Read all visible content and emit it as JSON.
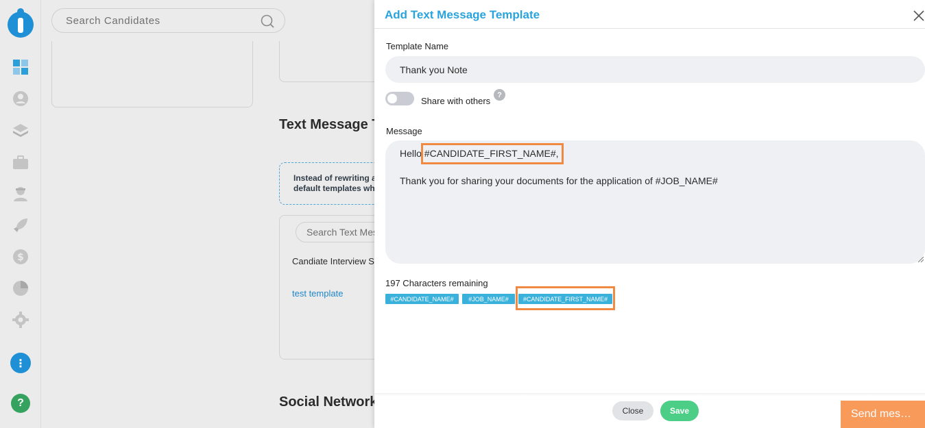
{
  "search": {
    "placeholder": "Search Candidates"
  },
  "background": {
    "text_message_heading": "Text Message T",
    "info_line1": "Instead of rewriting a",
    "info_line2": "default templates wh",
    "list_search_placeholder": "Search Text Mes",
    "list_header": "Candiate Interview S",
    "list_item": "test template",
    "social_heading": "Social Network"
  },
  "rail": {
    "icons": [
      "dashboard-icon",
      "user-icon",
      "layers-icon",
      "briefcase-icon",
      "agent-icon",
      "rocket-icon",
      "dollar-icon",
      "pie-chart-icon",
      "gear-icon"
    ],
    "more_glyph": "⋮",
    "help_glyph": "?"
  },
  "modal": {
    "title": "Add Text Message Template",
    "template_name_label": "Template Name",
    "template_name_value": "Thank you Note",
    "share_label": "Share with others",
    "share_enabled": false,
    "help_glyph": "?",
    "message_label": "Message",
    "message_line1": "Hello  #CANDIDATE_FIRST_NAME#,",
    "message_line2": "Thank you for sharing your documents for the application of  #JOB_NAME#",
    "chars_remaining": "197 Characters remaining",
    "placeholders": [
      "#CANDIDATE_NAME#",
      "#JOB_NAME#",
      "#CANDIDATE_FIRST_NAME#"
    ],
    "close_label": "Close",
    "save_label": "Save"
  },
  "send_message_button": "Send mes…",
  "colors": {
    "accent": "#2aa3dc",
    "save_green": "#4cce86",
    "chip_blue": "#3ab1db",
    "highlight_orange": "#f08a43",
    "send_orange": "#f89a5a"
  }
}
